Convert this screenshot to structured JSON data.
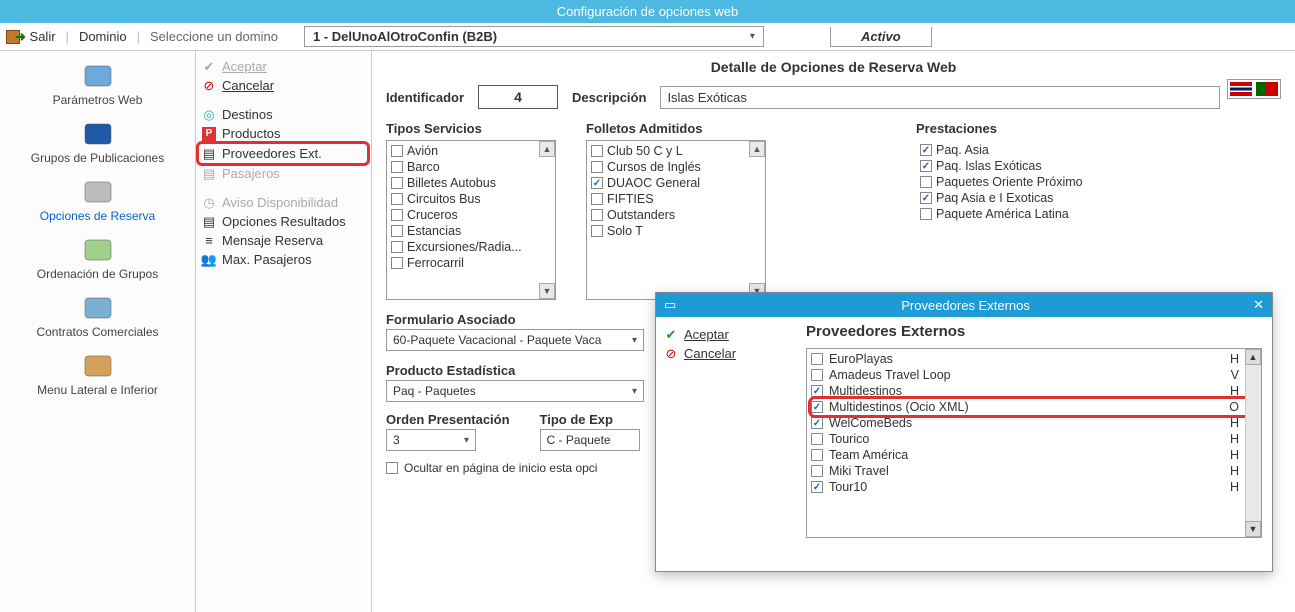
{
  "window": {
    "title": "Configuración de opciones web"
  },
  "toolbar": {
    "salir": "Salir",
    "dominio": "Dominio",
    "dominio_hint": "Seleccione un domino",
    "domain_selected": "1 - DelUnoAlOtroConfin (B2B)",
    "activo": "Activo"
  },
  "sidebar1": [
    {
      "label": "Parámetros Web",
      "name": "parametros-web",
      "color": "#6fa8dc"
    },
    {
      "label": "Grupos de Publicaciones",
      "name": "grupos-publicaciones",
      "color": "#1f5aa6"
    },
    {
      "label": "Opciones de Reserva",
      "name": "opciones-reserva",
      "color": "#bdbdbd",
      "selected": true
    },
    {
      "label": "Ordenación de Grupos",
      "name": "ordenacion-grupos",
      "color": "#9fd08c"
    },
    {
      "label": "Contratos Comerciales",
      "name": "contratos-comerciales",
      "color": "#7ab0d1"
    },
    {
      "label": "Menu Lateral e Inferior",
      "name": "menu-lateral",
      "color": "#d4a15a"
    }
  ],
  "sidebar2": {
    "aceptar": "Aceptar",
    "cancelar": "Cancelar",
    "destinos": "Destinos",
    "productos": "Productos",
    "proveedores_ext": "Proveedores Ext.",
    "pasajeros": "Pasajeros",
    "aviso": "Aviso Disponibilidad",
    "opciones_res": "Opciones Resultados",
    "mensaje": "Mensaje Reserva",
    "max_pax": "Max. Pasajeros"
  },
  "content": {
    "subtitle": "Detalle de Opciones de Reserva Web",
    "identificador_lbl": "Identificador",
    "identificador_val": "4",
    "descripcion_lbl": "Descripción",
    "descripcion_val": "Islas Exóticas",
    "tipos_lbl": "Tipos Servicios",
    "tipos": [
      "Avión",
      "Barco",
      "Billetes Autobus",
      "Circuitos Bus",
      "Cruceros",
      "Estancias",
      "Excursiones/Radia...",
      "Ferrocarril"
    ],
    "folletos_lbl": "Folletos Admitidos",
    "folletos": [
      {
        "label": "Club 50 C y L",
        "checked": false
      },
      {
        "label": "Cursos de Inglés",
        "checked": false
      },
      {
        "label": "DUAOC General",
        "checked": true
      },
      {
        "label": "FIFTIES",
        "checked": false
      },
      {
        "label": "Outstanders",
        "checked": false
      },
      {
        "label": "Solo T",
        "checked": false
      }
    ],
    "prestaciones_lbl": "Prestaciones",
    "prestaciones": [
      {
        "label": "Paq. Asia",
        "checked": true
      },
      {
        "label": "Paq. Islas Exóticas",
        "checked": true
      },
      {
        "label": "Paquetes Oriente Próximo",
        "checked": false
      },
      {
        "label": "Paq Asia e I Exoticas",
        "checked": true
      },
      {
        "label": "Paquete América Latina",
        "checked": false
      }
    ],
    "formulario_lbl": "Formulario Asociado",
    "formulario_val": "60-Paquete Vacacional - Paquete Vaca",
    "producto_lbl": "Producto Estadística",
    "producto_val": "Paq - Paquetes",
    "orden_lbl": "Orden Presentación",
    "orden_val": "3",
    "tipo_exp_lbl": "Tipo de Exp",
    "tipo_exp_val": "C - Paquete",
    "ocultar_lbl": "Ocultar en página de inicio esta opci"
  },
  "dialog": {
    "title": "Proveedores Externos",
    "aceptar": "Aceptar",
    "cancelar": "Cancelar",
    "heading": "Proveedores Externos",
    "rows": [
      {
        "label": "EuroPlayas",
        "checked": false,
        "code": "H"
      },
      {
        "label": "Amadeus Travel Loop",
        "checked": false,
        "code": "V"
      },
      {
        "label": "Multidestinos",
        "checked": true,
        "code": "H"
      },
      {
        "label": "Multidestinos (Ocio XML)",
        "checked": true,
        "code": "O",
        "highlight": true
      },
      {
        "label": "WelComeBeds",
        "checked": true,
        "code": "H"
      },
      {
        "label": "Tourico",
        "checked": false,
        "code": "H"
      },
      {
        "label": "Team América",
        "checked": false,
        "code": "H"
      },
      {
        "label": "Miki Travel",
        "checked": false,
        "code": "H"
      },
      {
        "label": "Tour10",
        "checked": true,
        "code": "H"
      }
    ]
  }
}
